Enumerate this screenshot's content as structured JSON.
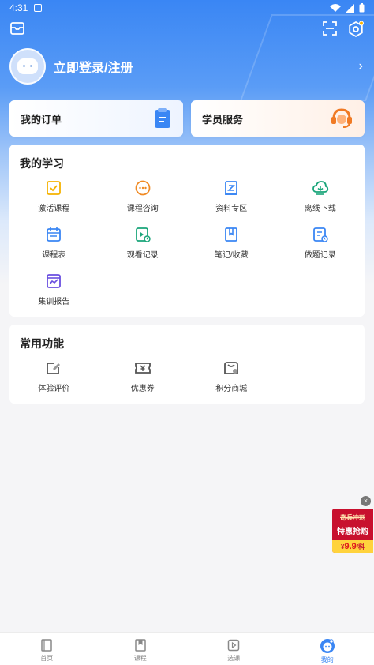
{
  "status_bar": {
    "time": "4:31"
  },
  "profile": {
    "login_text": "立即登录/注册",
    "chevron": "›"
  },
  "quick_cards": {
    "orders_label": "我的订单",
    "service_label": "学员服务"
  },
  "study": {
    "title": "我的学习",
    "items": [
      {
        "label": "激活课程",
        "icon": "activate-course-icon"
      },
      {
        "label": "课程咨询",
        "icon": "consult-icon"
      },
      {
        "label": "资料专区",
        "icon": "materials-icon"
      },
      {
        "label": "离线下载",
        "icon": "download-icon"
      },
      {
        "label": "课程表",
        "icon": "schedule-icon"
      },
      {
        "label": "观看记录",
        "icon": "watch-history-icon"
      },
      {
        "label": "笔记/收藏",
        "icon": "notes-icon"
      },
      {
        "label": "做题记录",
        "icon": "exercise-record-icon"
      },
      {
        "label": "集训报告",
        "icon": "report-icon"
      }
    ]
  },
  "common": {
    "title": "常用功能",
    "items": [
      {
        "label": "体验评价",
        "icon": "review-icon"
      },
      {
        "label": "优惠券",
        "icon": "coupon-icon"
      },
      {
        "label": "积分商城",
        "icon": "points-mall-icon"
      }
    ]
  },
  "promo": {
    "close": "×",
    "line1": "奇兵冲刺",
    "line2": "特惠抢购",
    "price_prefix": "¥",
    "price_value": "9.9",
    "price_suffix": "/科"
  },
  "tabs": [
    {
      "label": "首页",
      "active": false
    },
    {
      "label": "课程",
      "active": false
    },
    {
      "label": "选课",
      "active": false
    },
    {
      "label": "我的",
      "active": true
    }
  ],
  "colors": {
    "accent": "#3a86f4",
    "study_icon_orange": "#f08a24",
    "study_icon_blue": "#3a86f4",
    "study_icon_green": "#1aa57a",
    "study_icon_purple": "#6a4fe0",
    "common_icon_gray": "#555555"
  }
}
